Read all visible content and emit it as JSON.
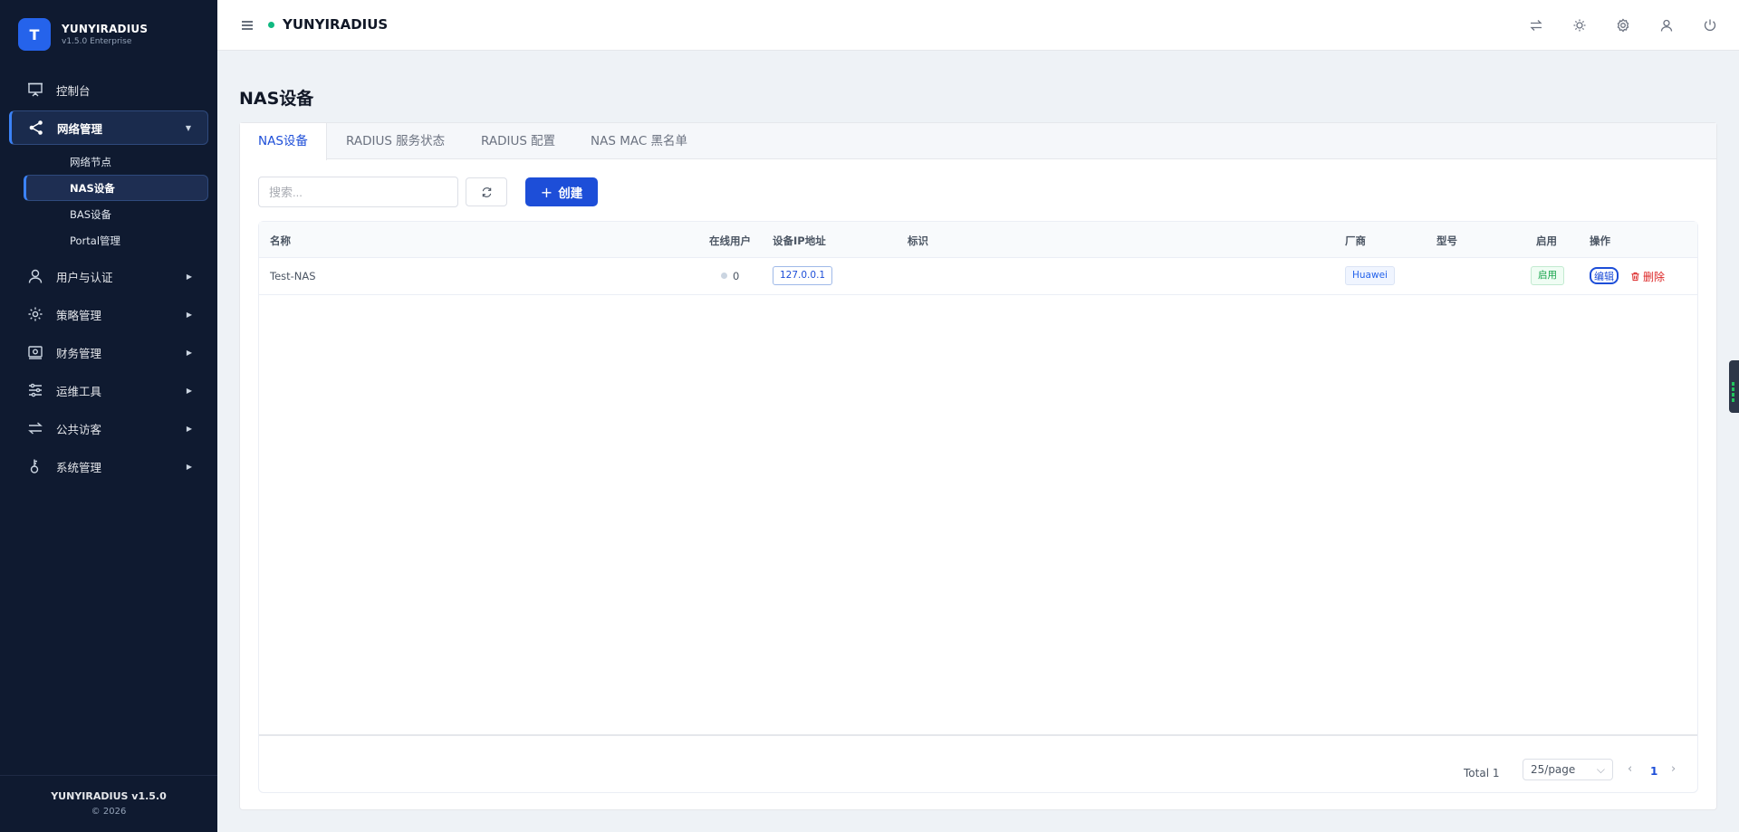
{
  "brand": {
    "initial": "T",
    "name": "YUNYIRADIUS",
    "version": "v1.5.0 Enterprise"
  },
  "sidebar": {
    "items": [
      {
        "label": "控制台",
        "icon": "presentation-icon"
      },
      {
        "label": "网络管理",
        "icon": "share-icon",
        "expanded": true,
        "children": [
          {
            "label": "网络节点"
          },
          {
            "label": "NAS设备",
            "active": true
          },
          {
            "label": "BAS设备"
          },
          {
            "label": "Portal管理"
          }
        ]
      },
      {
        "label": "用户与认证",
        "icon": "user-icon"
      },
      {
        "label": "策略管理",
        "icon": "gear-icon"
      },
      {
        "label": "财务管理",
        "icon": "wallet-icon"
      },
      {
        "label": "运维工具",
        "icon": "sliders-icon"
      },
      {
        "label": "公共访客",
        "icon": "swap-icon"
      },
      {
        "label": "系统管理",
        "icon": "key-icon"
      }
    ],
    "footer": {
      "title": "YUNYIRADIUS v1.5.0",
      "copyright": "© 2026"
    }
  },
  "header": {
    "title": "YUNYIRADIUS",
    "status_color": "#10b981",
    "icons": [
      "swap-icon",
      "sun-icon",
      "gear-icon",
      "user-icon",
      "power-icon"
    ]
  },
  "page": {
    "title": "NAS设备"
  },
  "tabs": [
    {
      "label": "NAS设备",
      "active": true
    },
    {
      "label": "RADIUS 服务状态"
    },
    {
      "label": "RADIUS 配置"
    },
    {
      "label": "NAS MAC 黑名单"
    }
  ],
  "toolbar": {
    "search_placeholder": "搜索...",
    "create_label": "创建"
  },
  "table": {
    "columns": [
      "名称",
      "在线用户",
      "设备IP地址",
      "标识",
      "厂商",
      "型号",
      "启用",
      "操作"
    ],
    "rows": [
      {
        "name": "Test-NAS",
        "online": "0",
        "ip": "127.0.0.1",
        "identifier": "",
        "vendor": "Huawei",
        "model": "",
        "enabled": "启用",
        "edit": "编辑",
        "delete": "删除"
      }
    ]
  },
  "pagination": {
    "total": "Total 1",
    "page_size": "25/page",
    "current_page": "1"
  },
  "colors": {
    "accent": "#1d4ed8",
    "sidebar_bg": "#0f1a30",
    "danger": "#dc2626",
    "success": "#16a34a"
  }
}
